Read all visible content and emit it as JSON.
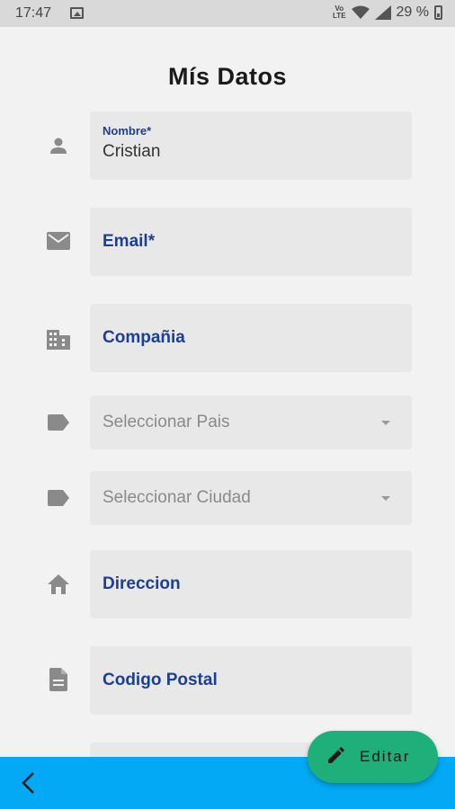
{
  "status_bar": {
    "time": "17:47",
    "network_badge": "Vo\nLTE",
    "battery_percent": "29 %",
    "icons": [
      "image-icon",
      "wifi-icon",
      "signal-icon",
      "battery-icon"
    ]
  },
  "header": {
    "title": "Mís Datos"
  },
  "form": {
    "nombre": {
      "label": "Nombre*",
      "value": "Cristian",
      "icon": "person-icon"
    },
    "email": {
      "label": "Email*",
      "icon": "mail-icon"
    },
    "compania": {
      "label": "Compañia",
      "icon": "building-icon"
    },
    "pais": {
      "placeholder": "Seleccionar Pais",
      "icon": "label-icon"
    },
    "ciudad": {
      "placeholder": "Seleccionar Ciudad",
      "icon": "label-icon"
    },
    "direccion": {
      "label": "Direccion",
      "icon": "home-icon"
    },
    "codigo_postal": {
      "label": "Codigo Postal",
      "icon": "document-icon"
    }
  },
  "fab": {
    "label": "Editar",
    "icon": "pencil-icon"
  },
  "bottom_bar": {
    "back_icon": "chevron-left-icon"
  },
  "colors": {
    "label_blue": "#1c3f94",
    "fab_green": "#1faf7a",
    "bottom_bar_blue": "#03a9f4",
    "field_bg": "#e8e8e8",
    "page_bg": "#f2f2f2"
  }
}
